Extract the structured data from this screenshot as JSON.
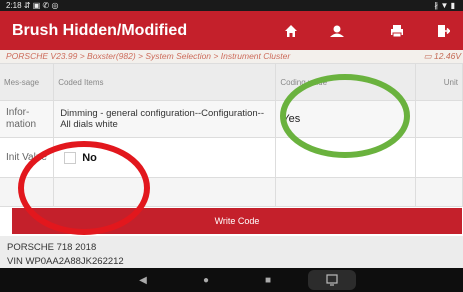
{
  "status_bar": {
    "time": "2:18",
    "left_icons": "⇵ ▣ ✆ ◎",
    "right_icons": "∦ ▼ ▮"
  },
  "header": {
    "title": "Brush Hidden/Modified",
    "home_icon": "home-icon",
    "user_icon": "user-icon",
    "print_icon": "print-icon",
    "exit_icon": "exit-icon"
  },
  "breadcrumb": {
    "path": "PORSCHE V23.99 > Boxster(982) > System Selection > Instrument Cluster",
    "voltage": "12.46V"
  },
  "table": {
    "headers": {
      "message": "Mes-sage",
      "coded_items": "Coded Items",
      "coding_value": "Coding value",
      "unit": "Unit"
    },
    "rows": [
      {
        "message": "Infor-mation",
        "item": "Dimming - general configuration--Configuration--All dials white",
        "value": "Yes",
        "unit": ""
      },
      {
        "message": "Init Value",
        "item": "No",
        "value": "",
        "unit": ""
      }
    ]
  },
  "write_button": "Write Code",
  "vehicle": {
    "model": "PORSCHE 718 2018",
    "vin": "VIN WP0AA2A88JK262212"
  },
  "annotations": {
    "green_circle_color": "#6ab23e",
    "red_circle_color": "#e2171d"
  },
  "colors": {
    "accent": "#c4202b"
  }
}
